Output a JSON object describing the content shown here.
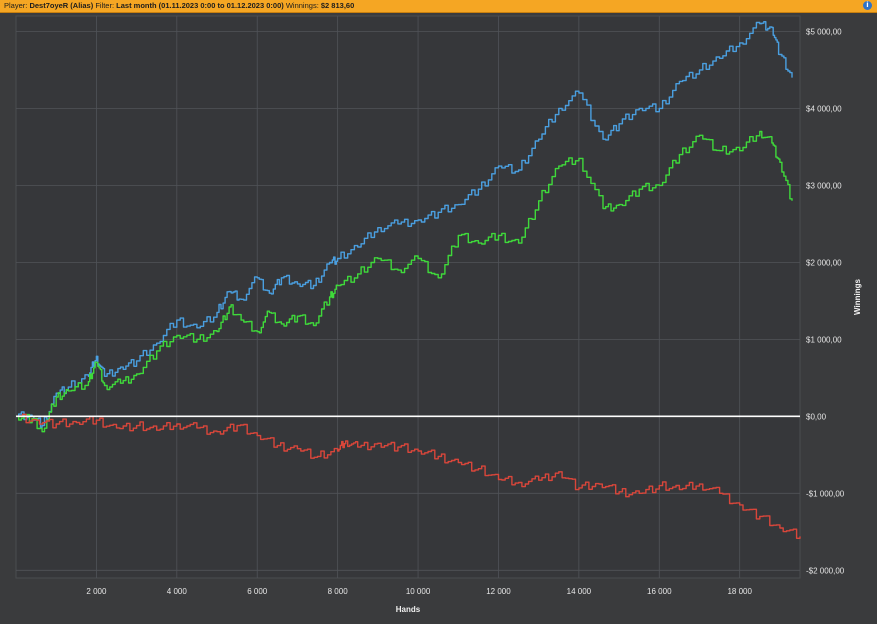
{
  "header": {
    "player_label": "Player:",
    "player_value": "Dest7oyeR (Alias)",
    "filter_label": "Filter:",
    "filter_value": "Last month (01.11.2023 0:00 to 01.12.2023 0:00)",
    "winnings_label": "Winnings:",
    "winnings_value": "$2 813,60",
    "info_icon": "info-icon"
  },
  "colors": {
    "background": "#3a3b3d",
    "plot_background": "#36373a",
    "grid": "#505358",
    "zero_line": "#ffffff",
    "series": [
      "#4a9fe0",
      "#3fd93a",
      "#d9463a"
    ]
  },
  "chart_data": {
    "type": "line",
    "xlabel": "Hands",
    "ylabel": "Winnings",
    "xlim": [
      0,
      19500
    ],
    "ylim": [
      -2100,
      5200
    ],
    "x_ticks": [
      2000,
      4000,
      6000,
      8000,
      10000,
      12000,
      14000,
      16000,
      18000
    ],
    "x_tick_labels": [
      "2 000",
      "4 000",
      "6 000",
      "8 000",
      "10 000",
      "12 000",
      "14 000",
      "16 000",
      "18 000"
    ],
    "y_ticks": [
      5000,
      4000,
      3000,
      2000,
      1000,
      0,
      -1000,
      -2000
    ],
    "y_tick_labels": [
      "$5 000,00",
      "$4 000,00",
      "$3 000,00",
      "$2 000,00",
      "$1 000,00",
      "$0,00",
      "-$1 000,00",
      "-$2 000,00"
    ],
    "grid": true,
    "series": [
      {
        "x": [
          0,
          400,
          650,
          1000,
          1300,
          1800,
          2000,
          2200,
          2600,
          3000,
          3500,
          4000,
          4500,
          5000,
          5300,
          5600,
          6000,
          6300,
          6600,
          7000,
          7400,
          7800,
          8000,
          8500,
          9000,
          9500,
          10000,
          10500,
          11000,
          11500,
          12000,
          12500,
          13000,
          13500,
          14000,
          14600,
          15000,
          15500,
          16000,
          16500,
          17000,
          17500,
          18000,
          18500,
          18800,
          19000,
          19300
        ],
        "y": [
          0,
          0,
          -120,
          300,
          380,
          520,
          780,
          520,
          640,
          720,
          950,
          1250,
          1150,
          1350,
          1620,
          1520,
          1800,
          1600,
          1800,
          1720,
          1700,
          2000,
          2050,
          2200,
          2450,
          2500,
          2550,
          2650,
          2750,
          2950,
          3250,
          3200,
          3600,
          4000,
          4200,
          3600,
          3800,
          4000,
          4000,
          4350,
          4500,
          4650,
          4850,
          5100,
          5050,
          4700,
          4400
        ]
      },
      {
        "x": [
          0,
          400,
          650,
          1000,
          1300,
          1800,
          2000,
          2200,
          2600,
          3000,
          3500,
          4000,
          4500,
          5000,
          5300,
          5600,
          6000,
          6300,
          6600,
          7000,
          7400,
          7800,
          8000,
          8500,
          9000,
          9500,
          10000,
          10500,
          11000,
          11500,
          12000,
          12500,
          13000,
          13500,
          14000,
          14600,
          15000,
          15500,
          16000,
          16500,
          17000,
          17500,
          18000,
          18500,
          18800,
          19000,
          19300
        ],
        "y": [
          0,
          -30,
          -200,
          250,
          330,
          450,
          700,
          400,
          430,
          550,
          850,
          1050,
          1000,
          1100,
          1420,
          1250,
          1100,
          1350,
          1200,
          1300,
          1180,
          1550,
          1700,
          1850,
          2050,
          1900,
          2050,
          1800,
          2350,
          2250,
          2350,
          2250,
          2800,
          3250,
          3350,
          2700,
          2750,
          2950,
          3000,
          3400,
          3650,
          3450,
          3450,
          3700,
          3550,
          3300,
          2800
        ]
      },
      {
        "x": [
          0,
          500,
          1000,
          1500,
          2000,
          2500,
          3000,
          3500,
          4000,
          4500,
          5000,
          5500,
          6000,
          6500,
          7000,
          7500,
          8000,
          8200,
          8500,
          9000,
          9500,
          10000,
          10500,
          11000,
          11500,
          12000,
          12500,
          13000,
          13500,
          14000,
          14500,
          15000,
          15500,
          16000,
          16500,
          17000,
          17500,
          18000,
          18500,
          19000,
          19500
        ],
        "y": [
          0,
          -50,
          -100,
          -80,
          -50,
          -150,
          -120,
          -180,
          -100,
          -150,
          -200,
          -120,
          -250,
          -380,
          -420,
          -520,
          -450,
          -320,
          -400,
          -350,
          -400,
          -450,
          -520,
          -600,
          -680,
          -820,
          -860,
          -830,
          -720,
          -930,
          -880,
          -980,
          -1000,
          -900,
          -950,
          -880,
          -1000,
          -1150,
          -1300,
          -1450,
          -1560
        ]
      }
    ]
  }
}
